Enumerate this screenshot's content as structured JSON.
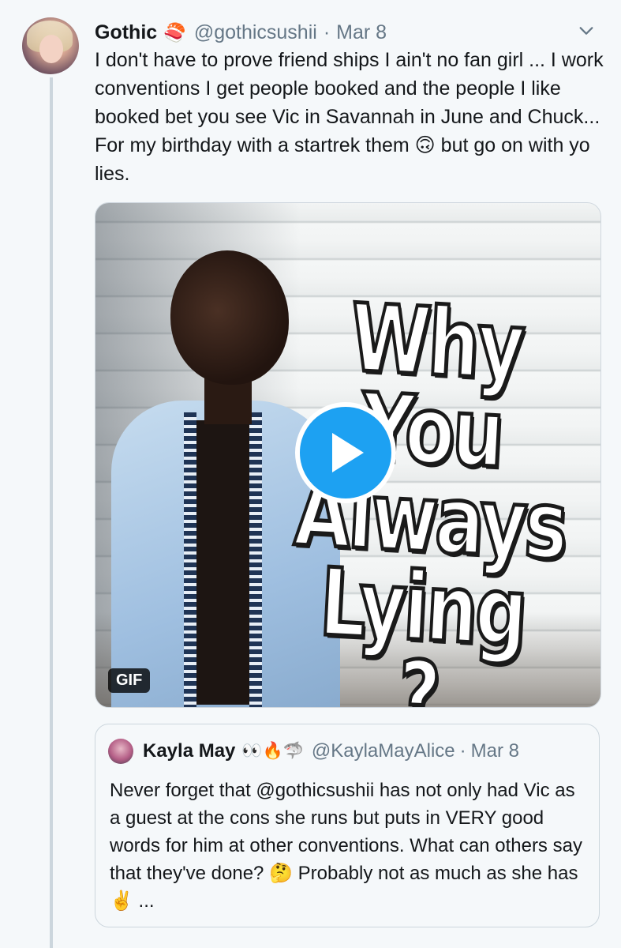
{
  "tweet": {
    "display_name": "Gothic",
    "name_emoji": "🍣",
    "handle": "@gothicsushii",
    "separator": "·",
    "date": "Mar 8",
    "text": "I don't have to prove friend ships I ain't no fan girl ... I work conventions I get people booked and the people I like booked bet you see Vic in Savannah in June and Chuck... For my birthday with a startrek them 🙃 but go on with yo lies."
  },
  "media": {
    "meme_text": "Why You Always Lying ?",
    "badge": "GIF"
  },
  "quoted_tweet": {
    "display_name": "Kayla May",
    "name_emoji": "👀🔥🦈",
    "handle": "@KaylaMayAlice",
    "separator": "·",
    "date": "Mar 8",
    "text": "Never forget that @gothicsushii has not only had Vic as a guest at the cons she runs but puts in VERY good words for him at other conventions. What can others say that they've done? 🤔 Probably not as much as she has ✌️ ..."
  },
  "colors": {
    "background": "#f5f8fa",
    "accent": "#1da1f2",
    "secondary_text": "#657786",
    "thread_line": "#ccd6dd"
  },
  "icons": {
    "caret": "chevron-down-icon",
    "play": "play-icon"
  }
}
